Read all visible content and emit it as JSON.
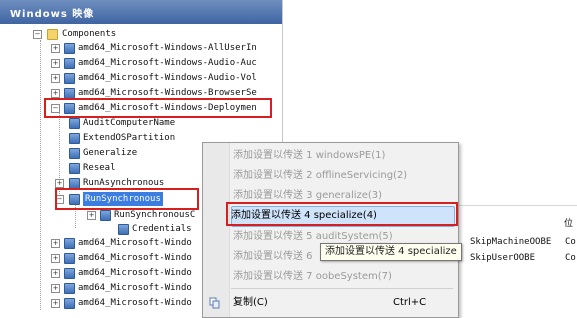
{
  "window": {
    "title": "Windows 映像"
  },
  "tree": {
    "components_label": "Components",
    "items": [
      "amd64_Microsoft-Windows-AllUserIn",
      "amd64_Microsoft-Windows-Audio-Auc",
      "amd64_Microsoft-Windows-Audio-Vol",
      "amd64_Microsoft-Windows-BrowserSe",
      "amd64_Microsoft-Windows-Deploymen"
    ],
    "deployment_children": [
      "AuditComputerName",
      "ExtendOSPartition",
      "Generalize",
      "Reseal",
      "RunAsynchronous",
      "RunSynchronous"
    ],
    "runsync_child": "RunSynchronousC",
    "credentials": "Credentials",
    "after_items": [
      "amd64_Microsoft-Windo",
      "amd64_Microsoft-Windo",
      "amd64_Microsoft-Windo",
      "amd64_Microsoft-Windo",
      "amd64_Microsoft-Windo"
    ]
  },
  "context_menu": {
    "items": [
      "添加设置以传送 1 windowsPE(1)",
      "添加设置以传送 2 offlineServicing(2)",
      "添加设置以传送 3 generalize(3)",
      "添加设置以传送 4 specialize(4)",
      "添加设置以传送 5 auditSystem(5)",
      "添加设置以传送 6",
      "添加设置以传送 7 oobeSystem(7)"
    ],
    "copy_label": "复制(C)",
    "copy_shortcut": "Ctrl+C"
  },
  "tooltip": {
    "text": "添加设置以传送 4 specialize"
  },
  "right_grid": {
    "header": "位",
    "rows": [
      {
        "name": "SkipMachineOOBE",
        "value": "Co"
      },
      {
        "name": "SkipUserOOBE",
        "value": "Co"
      }
    ]
  },
  "colors": {
    "selection": "#3b7de0",
    "highlight_box": "#d62020",
    "menu_active": "#cfe3fb"
  }
}
